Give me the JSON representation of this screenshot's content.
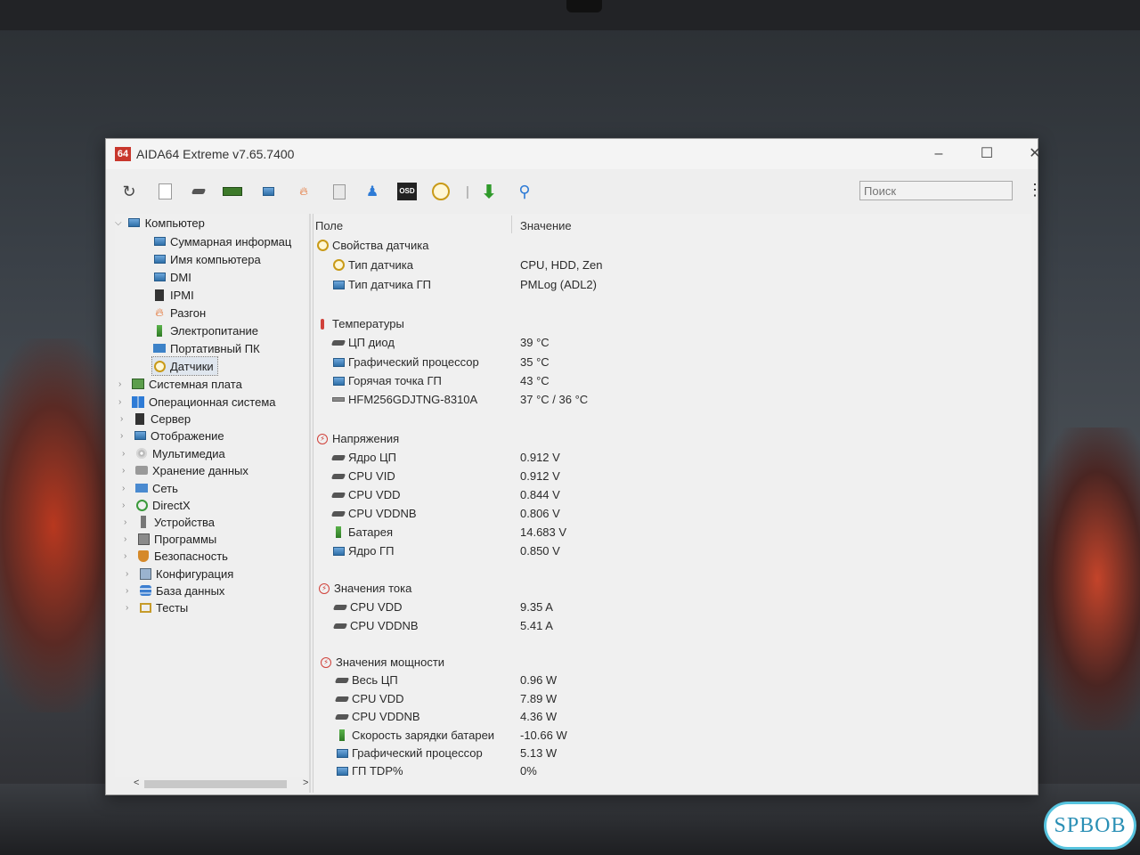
{
  "window": {
    "app_icon": "64",
    "title": "AIDA64 Extreme v7.65.7400"
  },
  "controls": {
    "minimize": "–",
    "maximize": "☐",
    "close": "✕"
  },
  "toolbar": {
    "search_placeholder": "Поиск",
    "menu_glyph": "⋮",
    "osd_label": "OSD",
    "icons": [
      "refresh-icon",
      "report-icon",
      "motherboard-icon",
      "memory-icon",
      "network-icon",
      "flame-icon",
      "clipboard-icon",
      "user-icon",
      "osd-icon",
      "gauge-icon",
      "download-icon",
      "search-icon"
    ]
  },
  "tree": {
    "items": [
      {
        "label": "Компьютер",
        "icon": "computer-icon"
      },
      {
        "label": "Суммарная информац",
        "icon": "summary-icon"
      },
      {
        "label": "Имя компьютера",
        "icon": "computer-name-icon"
      },
      {
        "label": "DMI",
        "icon": "dmi-icon"
      },
      {
        "label": "IPMI",
        "icon": "ipmi-icon"
      },
      {
        "label": "Разгон",
        "icon": "overclock-icon"
      },
      {
        "label": "Электропитание",
        "icon": "power-icon"
      },
      {
        "label": "Портативный ПК",
        "icon": "laptop-icon"
      },
      {
        "label": "Датчики",
        "icon": "sensors-icon"
      },
      {
        "label": "Системная плата",
        "icon": "motherboard-icon"
      },
      {
        "label": "Операционная система",
        "icon": "windows-icon"
      },
      {
        "label": "Сервер",
        "icon": "server-icon"
      },
      {
        "label": "Отображение",
        "icon": "display-icon"
      },
      {
        "label": "Мультимедиа",
        "icon": "multimedia-icon"
      },
      {
        "label": "Хранение данных",
        "icon": "storage-icon"
      },
      {
        "label": "Сеть",
        "icon": "network-icon"
      },
      {
        "label": "DirectX",
        "icon": "directx-icon"
      },
      {
        "label": "Устройства",
        "icon": "devices-icon"
      },
      {
        "label": "Программы",
        "icon": "programs-icon"
      },
      {
        "label": "Безопасность",
        "icon": "security-icon"
      },
      {
        "label": "Конфигурация",
        "icon": "config-icon"
      },
      {
        "label": "База данных",
        "icon": "database-icon"
      },
      {
        "label": "Тесты",
        "icon": "tests-icon"
      }
    ],
    "scroll_left": "<",
    "scroll_right": ">"
  },
  "table": {
    "col_field": "Поле",
    "col_value": "Значение",
    "groups": [
      {
        "name": "Свойства датчика",
        "icon": "gauge-icon",
        "rows": [
          {
            "field": "Тип датчика",
            "value": "CPU, HDD, Zen",
            "icon": "gauge-icon"
          },
          {
            "field": "Тип датчика ГП",
            "value": "PMLog  (ADL2)",
            "icon": "gpu-icon"
          }
        ]
      },
      {
        "name": "Температуры",
        "icon": "thermometer-icon",
        "rows": [
          {
            "field": "ЦП диод",
            "value": "39 °C",
            "icon": "cpu-icon"
          },
          {
            "field": "Графический процессор",
            "value": "35 °C",
            "icon": "gpu-icon"
          },
          {
            "field": "Горячая точка ГП",
            "value": "43 °C",
            "icon": "gpu-icon"
          },
          {
            "field": "HFM256GDJTNG-8310A",
            "value": "37 °C / 36 °C",
            "icon": "disk-icon"
          }
        ]
      },
      {
        "name": "Напряжения",
        "icon": "voltage-icon",
        "rows": [
          {
            "field": "Ядро ЦП",
            "value": "0.912 V",
            "icon": "cpu-icon"
          },
          {
            "field": "CPU VID",
            "value": "0.912 V",
            "icon": "cpu-icon"
          },
          {
            "field": "CPU VDD",
            "value": "0.844 V",
            "icon": "cpu-icon"
          },
          {
            "field": "CPU VDDNB",
            "value": "0.806 V",
            "icon": "cpu-icon"
          },
          {
            "field": "Батарея",
            "value": "14.683 V",
            "icon": "battery-icon"
          },
          {
            "field": "Ядро ГП",
            "value": "0.850 V",
            "icon": "gpu-icon"
          }
        ]
      },
      {
        "name": "Значения тока",
        "icon": "current-icon",
        "rows": [
          {
            "field": "CPU VDD",
            "value": "9.35 A",
            "icon": "cpu-icon"
          },
          {
            "field": "CPU VDDNB",
            "value": "5.41 A",
            "icon": "cpu-icon"
          }
        ]
      },
      {
        "name": "Значения мощности",
        "icon": "power-value-icon",
        "rows": [
          {
            "field": "Весь ЦП",
            "value": "0.96 W",
            "icon": "cpu-icon"
          },
          {
            "field": "CPU VDD",
            "value": "7.89 W",
            "icon": "cpu-icon"
          },
          {
            "field": "CPU VDDNB",
            "value": "4.36 W",
            "icon": "cpu-icon"
          },
          {
            "field": "Скорость зарядки батареи",
            "value": "-10.66 W",
            "icon": "battery-icon"
          },
          {
            "field": "Графический процессор",
            "value": "5.13 W",
            "icon": "gpu-icon"
          },
          {
            "field": "ГП TDP%",
            "value": "0%",
            "icon": "gpu-icon"
          }
        ]
      }
    ]
  },
  "watermark": "SPBOB"
}
